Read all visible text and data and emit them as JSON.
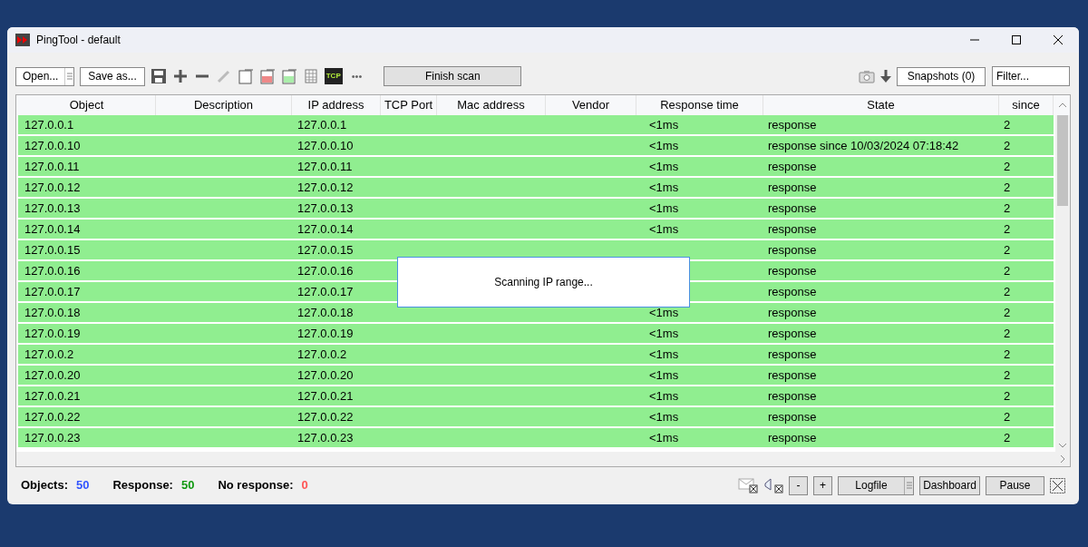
{
  "window": {
    "title": "PingTool - default"
  },
  "toolbar": {
    "open": "Open...",
    "save_as": "Save as...",
    "tcp_badge": "TCP",
    "more": "•••",
    "finish": "Finish scan",
    "snapshots": "Snapshots (0)",
    "filter_placeholder": "Filter..."
  },
  "table": {
    "columns": [
      "Object",
      "Description",
      "IP address",
      "TCP Port",
      "Mac address",
      "Vendor",
      "Response time",
      "State",
      "since"
    ],
    "rows": [
      {
        "object": "127.0.0.1",
        "ip": "127.0.0.1",
        "response_time": "<1ms",
        "state": "response",
        "since": "2"
      },
      {
        "object": "127.0.0.10",
        "ip": "127.0.0.10",
        "response_time": "<1ms",
        "state": "response since 10/03/2024 07:18:42",
        "since": "2"
      },
      {
        "object": "127.0.0.11",
        "ip": "127.0.0.11",
        "response_time": "<1ms",
        "state": "response",
        "since": "2"
      },
      {
        "object": "127.0.0.12",
        "ip": "127.0.0.12",
        "response_time": "<1ms",
        "state": "response",
        "since": "2"
      },
      {
        "object": "127.0.0.13",
        "ip": "127.0.0.13",
        "response_time": "<1ms",
        "state": "response",
        "since": "2"
      },
      {
        "object": "127.0.0.14",
        "ip": "127.0.0.14",
        "response_time": "<1ms",
        "state": "response",
        "since": "2"
      },
      {
        "object": "127.0.0.15",
        "ip": "127.0.0.15",
        "state": "response",
        "since": "2"
      },
      {
        "object": "127.0.0.16",
        "ip": "127.0.0.16",
        "state": "response",
        "since": "2"
      },
      {
        "object": "127.0.0.17",
        "ip": "127.0.0.17",
        "state": "response",
        "since": "2"
      },
      {
        "object": "127.0.0.18",
        "ip": "127.0.0.18",
        "response_time": "<1ms",
        "state": "response",
        "since": "2"
      },
      {
        "object": "127.0.0.19",
        "ip": "127.0.0.19",
        "response_time": "<1ms",
        "state": "response",
        "since": "2"
      },
      {
        "object": "127.0.0.2",
        "ip": "127.0.0.2",
        "response_time": "<1ms",
        "state": "response",
        "since": "2"
      },
      {
        "object": "127.0.0.20",
        "ip": "127.0.0.20",
        "response_time": "<1ms",
        "state": "response",
        "since": "2"
      },
      {
        "object": "127.0.0.21",
        "ip": "127.0.0.21",
        "response_time": "<1ms",
        "state": "response",
        "since": "2"
      },
      {
        "object": "127.0.0.22",
        "ip": "127.0.0.22",
        "response_time": "<1ms",
        "state": "response",
        "since": "2"
      },
      {
        "object": "127.0.0.23",
        "ip": "127.0.0.23",
        "response_time": "<1ms",
        "state": "response",
        "since": "2"
      }
    ]
  },
  "dialog": {
    "message": "Scanning IP range..."
  },
  "status": [
    {
      "label": "Objects:",
      "value": "50",
      "color": "#3355ff"
    },
    {
      "label": "Response:",
      "value": "50",
      "color": "#119911"
    },
    {
      "label": "No response:",
      "value": "0",
      "color": "#ff5555"
    }
  ],
  "footer": {
    "minus": "-",
    "plus": "+",
    "logfile": "Logfile",
    "dashboard": "Dashboard",
    "pause": "Pause"
  }
}
